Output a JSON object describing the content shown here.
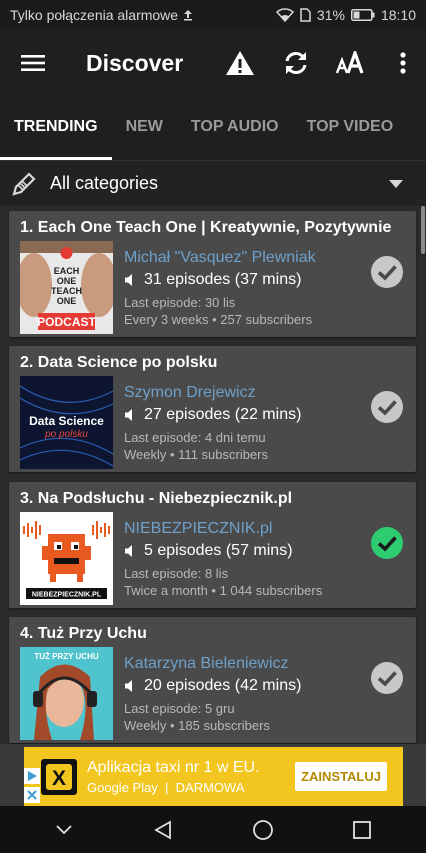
{
  "status_bar": {
    "carrier_text": "Tylko połączenia alarmowe",
    "battery": "31%",
    "time": "18:10"
  },
  "app_bar": {
    "title": "Discover",
    "icons": [
      "menu-icon",
      "warning-icon",
      "refresh-icon",
      "text-size-icon",
      "more-vert-icon"
    ]
  },
  "tabs": [
    {
      "label": "TRENDING",
      "active": true
    },
    {
      "label": "NEW",
      "active": false
    },
    {
      "label": "TOP AUDIO",
      "active": false
    },
    {
      "label": "TOP VIDEO",
      "active": false
    }
  ],
  "category": {
    "label": "All categories",
    "icon": "pencil-icon"
  },
  "podcasts": [
    {
      "title": "1. Each One Teach One | Kreatywnie, Pozytywnie",
      "author": "Michał \"Vasquez\" Plewniak",
      "episodes": "31 episodes (37 mins)",
      "last_episode": "Last episode: 30 lis",
      "frequency": "Every 3 weeks • 257 subscribers",
      "subscribed": false,
      "cover_text": [
        "EACH",
        "ONE",
        "TEACH",
        "ONE",
        "PODCAST"
      ]
    },
    {
      "title": "2. Data Science po polsku",
      "author": "Szymon Drejewicz",
      "episodes": "27 episodes (22 mins)",
      "last_episode": "Last episode: 4 dni temu",
      "frequency": "Weekly • 111 subscribers",
      "subscribed": false,
      "cover_text": [
        "Data Science",
        "po polsku"
      ]
    },
    {
      "title": "3. Na Podsłuchu - Niebezpiecznik.pl",
      "author": "NIEBEZPIECZNIK.pl",
      "episodes": "5 episodes (57 mins)",
      "last_episode": "Last episode: 8 lis",
      "frequency": "Twice a month • 1 044 subscribers",
      "subscribed": true,
      "cover_text": [
        "NIEBEZPIECZNIK.PL"
      ]
    },
    {
      "title": "4. Tuż Przy Uchu",
      "author": "Katarzyna Bieleniewicz",
      "episodes": "20 episodes (42 mins)",
      "last_episode": "Last episode: 5 gru",
      "frequency": "Weekly • 185 subscribers",
      "subscribed": false,
      "cover_text": [
        "TUŻ PRZY UCHU"
      ]
    }
  ],
  "ad": {
    "title": "Aplikacja taxi nr 1 w EU.",
    "source": "Google Play",
    "price": "DARMOWA",
    "button": "ZAINSTALUJ",
    "logo_letter": "X"
  },
  "colors": {
    "link": "#6fa0c9",
    "card": "#4a4a4a",
    "subscribed_check": "#2ecc71",
    "unsubscribed_check": "#c8c8c8",
    "ad_background": "#f3c61f"
  }
}
